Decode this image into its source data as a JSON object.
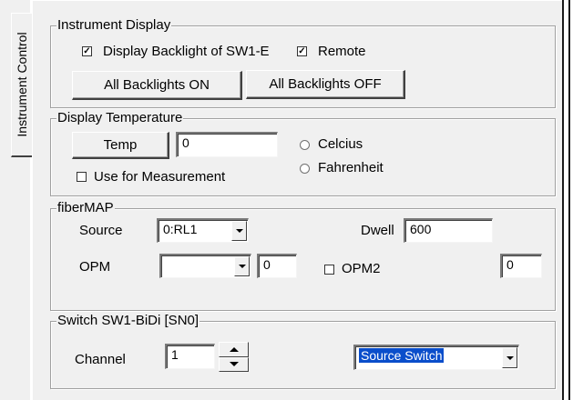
{
  "tabs": {
    "vertical_tab_label": "Instrument Control"
  },
  "instrument_display": {
    "title": "Instrument Display",
    "backlight_checkbox_label": "Display Backlight of SW1-E",
    "backlight_checked": true,
    "remote_checkbox_label": "Remote",
    "remote_checked": true,
    "all_on_label": "All Backlights ON",
    "all_off_label": "All Backlights OFF"
  },
  "display_temperature": {
    "title": "Display Temperature",
    "temp_button_label": "Temp",
    "temp_value": "0",
    "celcius_label": "Celcius",
    "fahrenheit_label": "Fahrenheit",
    "use_measurement_label": "Use for Measurement",
    "use_measurement_checked": false
  },
  "fibermap": {
    "title": "fiberMAP",
    "source_label": "Source",
    "source_value": "0:RL1",
    "dwell_label": "Dwell",
    "dwell_value": "600",
    "opm_label": "OPM",
    "opm_select_value": "",
    "opm_value": "0",
    "opm2_label": "OPM2",
    "opm2_checked": false,
    "opm2_value": "0"
  },
  "switch": {
    "title": "Switch SW1-BiDi [SN0]",
    "channel_label": "Channel",
    "channel_value": "1",
    "switch_type_value": "Source Switch"
  },
  "icons": {
    "checkbox_mark": "✓",
    "dropdown": "chevron-down-icon",
    "spin_up": "spin-up-icon",
    "spin_down": "spin-down-icon"
  }
}
